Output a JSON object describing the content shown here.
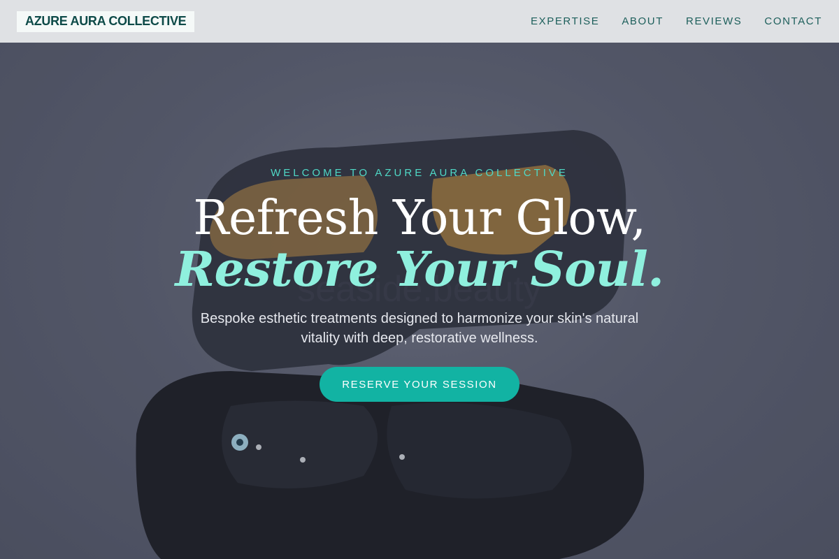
{
  "header": {
    "brand": "AZURE AURA COLLECTIVE",
    "nav": [
      "EXPERTISE",
      "ABOUT",
      "REVIEWS",
      "CONTACT"
    ]
  },
  "hero": {
    "eyebrow": "WELCOME TO AZURE AURA COLLECTIVE",
    "title_line1": "Refresh Your Glow,",
    "title_line2": "Restore Your Soul.",
    "subtitle": "Bespoke esthetic treatments designed to harmonize your skin's natural vitality with deep, restorative wellness.",
    "cta_label": "RESERVE YOUR SESSION",
    "background_watermark": "seaside.beauty"
  },
  "colors": {
    "header_bg": "#dfe1e4",
    "brand_text": "#0d4a48",
    "accent": "#12b3a3",
    "accent_light": "#8ff0de"
  }
}
